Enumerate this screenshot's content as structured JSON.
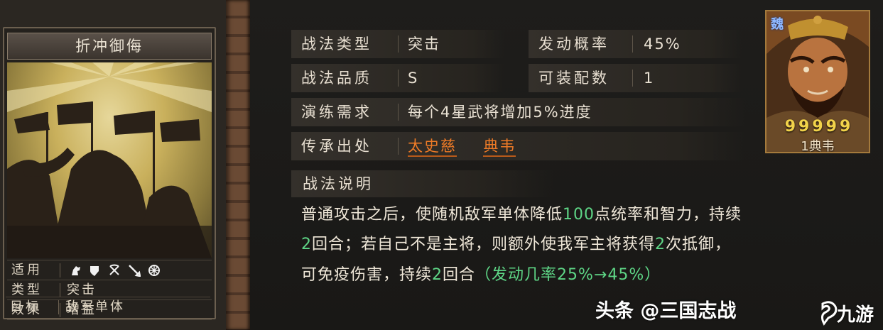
{
  "card": {
    "title": "折冲御侮",
    "rows": [
      {
        "label": "适用",
        "value": ""
      },
      {
        "label": "类型",
        "value": "突击"
      },
      {
        "label": "效果",
        "value": "增益"
      },
      {
        "label": "目标",
        "value": "敌军单体"
      }
    ],
    "applicable_icons": [
      "cavalry-icon",
      "shield-icon",
      "archer-icon",
      "spear-icon",
      "siege-icon"
    ]
  },
  "attributes": {
    "type_label": "战法类型",
    "type_value": "突击",
    "rate_label": "发动概率",
    "rate_value": "45%",
    "quality_label": "战法品质",
    "quality_value": "S",
    "slots_label": "可装配数",
    "slots_value": "1",
    "training_label": "演练需求",
    "training_value": "每个4星武将增加5%进度",
    "source_label": "传承出处",
    "source_links": [
      "太史慈",
      "典韦"
    ]
  },
  "description": {
    "title": "战法说明",
    "line1": {
      "t1": "普通攻击之后，使随机敌军单体降低",
      "h1": "100",
      "t2": "点统率和智力，持续"
    },
    "line2": {
      "h1": "2",
      "t1": "回合；若自己不是主将，则额外使我军主将获得",
      "h2": "2",
      "t2": "次抵御，"
    },
    "line3": {
      "t1": "可免疫伤害，持续",
      "h1": "2",
      "t2": "回合",
      "h2": "（发动几率25%→45%）"
    }
  },
  "general": {
    "faction": "魏",
    "stars": [
      "9",
      "9",
      "9",
      "9",
      "9"
    ],
    "name": "1典韦"
  },
  "watermark": {
    "text": "头条 @三国志战",
    "logo": "九游"
  },
  "colors": {
    "highlight": "#5ed686",
    "link": "#ec7a27",
    "star": "#f2d34a"
  }
}
